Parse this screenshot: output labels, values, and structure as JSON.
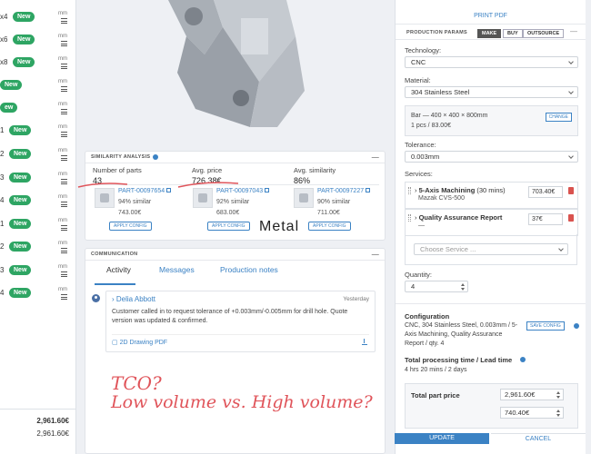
{
  "left_panel": {
    "rows": [
      {
        "qty": "x4",
        "badge": "New",
        "unit": "mm"
      },
      {
        "qty": "x6",
        "badge": "New",
        "unit": "mm"
      },
      {
        "qty": "x8",
        "badge": "New",
        "unit": "mm"
      },
      {
        "qty": "",
        "badge": "New",
        "unit": "mm"
      },
      {
        "qty": "",
        "badge": "ew",
        "unit": "mm"
      },
      {
        "qty": "1",
        "badge": "New",
        "unit": "mm"
      },
      {
        "qty": "2",
        "badge": "New",
        "unit": "mm"
      },
      {
        "qty": "3",
        "badge": "New",
        "unit": "mm"
      },
      {
        "qty": "4",
        "badge": "New",
        "unit": "mm"
      },
      {
        "qty": "1",
        "badge": "New",
        "unit": "mm"
      },
      {
        "qty": "2",
        "badge": "New",
        "unit": "mm"
      },
      {
        "qty": "3",
        "badge": "New",
        "unit": "mm"
      },
      {
        "qty": "4",
        "badge": "New",
        "unit": "mm"
      }
    ],
    "total_1": "2,961.60€",
    "total_2": "2,961.60€"
  },
  "similarity": {
    "title": "SIMILARITY ANALYSIS",
    "num_parts_label": "Number of parts",
    "num_parts_value": "43",
    "avg_price_label": "Avg. price",
    "avg_price_value": "726.38€",
    "avg_sim_label": "Avg. similarity",
    "avg_sim_value": "86%",
    "items": [
      {
        "part": "PART-00097654",
        "similar": "94% similar",
        "price": "743.00€",
        "button": "APPLY CONFIG"
      },
      {
        "part": "PART-00097043",
        "similar": "92% similar",
        "price": "683.00€",
        "button": "APPLY CONFIG"
      },
      {
        "part": "PART-00097227",
        "similar": "90% similar",
        "price": "711.00€",
        "button": "APPLY CONFIG"
      }
    ],
    "overlay_text": "Metal"
  },
  "communication": {
    "title": "COMMUNICATION",
    "tabs": [
      "Activity",
      "Messages",
      "Production notes"
    ],
    "message": {
      "author": "Delia Abbott",
      "time": "Yesterday",
      "body": "Customer called in to request tolerance of +0.003mm/-0.005mm for drill hole. Quote version was updated & confirmed.",
      "attachment": "2D Drawing PDF"
    }
  },
  "handwriting": {
    "line1": "TCO?",
    "line2": "Low volume vs. High volume?"
  },
  "production": {
    "print_pdf": "PRINT PDF",
    "title": "PRODUCTION PARAMS",
    "seg": [
      "MAKE",
      "BUY",
      "OUTSOURCE"
    ],
    "technology_label": "Technology:",
    "technology_value": "CNC",
    "material_label": "Material:",
    "material_value": "304 Stainless Steel",
    "bar_line1": "Bar — 400 × 400 × 800mm",
    "bar_line2": "1 pcs / 83.00€",
    "change": "CHANGE",
    "tolerance_label": "Tolerance:",
    "tolerance_value": "0.003mm",
    "services_label": "Services:",
    "services": [
      {
        "name": "5-Axis Machining",
        "extra": "(30 mins)",
        "sub": "Mazak CVS-500",
        "price": "703.40€"
      },
      {
        "name": "Quality Assurance Report",
        "extra": "",
        "sub": "—",
        "price": "37€"
      }
    ],
    "choose_service": "Choose Service ...",
    "quantity_label": "Quantity:",
    "quantity_value": "4",
    "config_label": "Configuration",
    "config_text": "CNC, 304 Stainless Steel, 0.003mm / 5-Axis Machining, Quality Assurance Report / qty. 4",
    "save_config": "SAVE CONFIG",
    "lead_label": "Total processing time / Lead time",
    "lead_value": "4 hrs 20 mins / 2 days",
    "total_label": "Total part price",
    "total_value": "2,961.60€",
    "unit_value": "740.40€",
    "update": "UPDATE",
    "cancel": "CANCEL"
  }
}
